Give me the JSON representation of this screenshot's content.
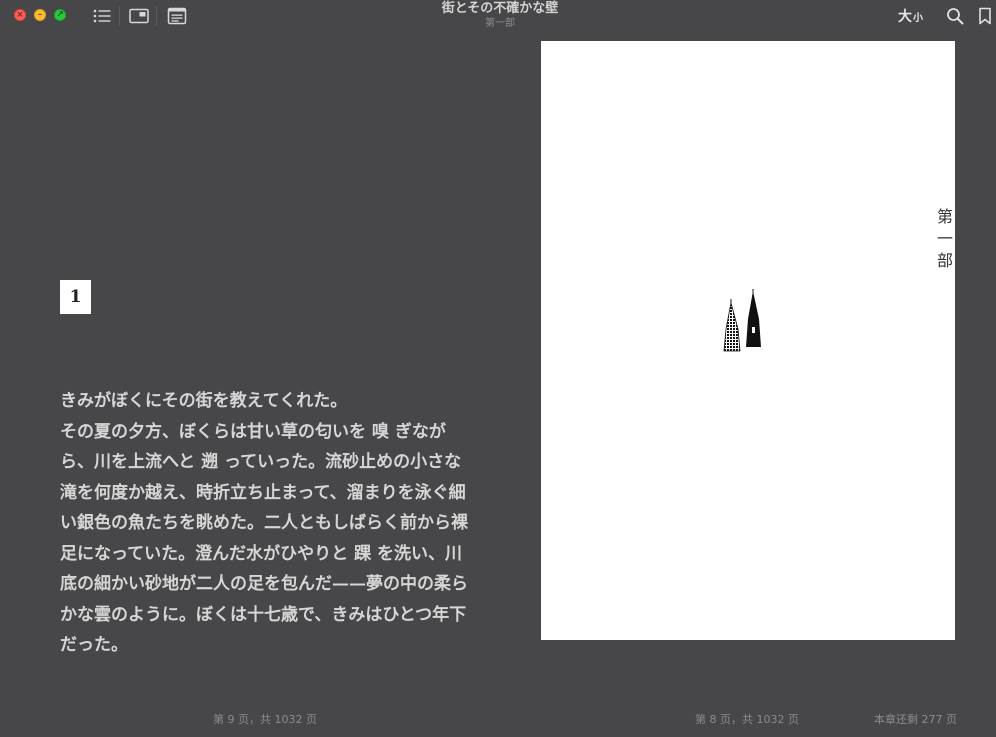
{
  "window": {
    "title": "街とその不確かな壁",
    "subtitle": "第一部"
  },
  "toolbar": {
    "font_size_big": "大",
    "font_size_small": "小",
    "icons": [
      "list-icon",
      "picture-in-picture-icon",
      "notes-icon",
      "search-icon",
      "bookmark-icon"
    ]
  },
  "left_page": {
    "chapter_number": "1",
    "paragraphs": [
      "きみがぼくにその街を教えてくれた。",
      "その夏の夕方、ぼくらは甘い草の匂いを 嗅 ぎながら、川を上流へと 遡 っていった。流砂止めの小さな滝を何度か越え、時折立ち止まって、溜まりを泳ぐ細い銀色の魚たちを眺めた。二人ともしばらく前から裸足になっていた。澄んだ水がひやりと 踝 を洗い、川底の細かい砂地が二人の足を包んだ——夢の中の柔らかな雲のように。ぼくは十七歳で、きみはひとつ年下だった。"
    ],
    "footer": "第 9 页，共 1032 页"
  },
  "right_page": {
    "part_title": "第一部",
    "footer": "第 8 页，共 1032 页",
    "remaining": "本章还剩 277 页"
  },
  "colors": {
    "background": "#474649",
    "page_white": "#ffffff",
    "text": "#d6d6d6",
    "close": "#ff5f57",
    "minimize": "#febc2e",
    "zoom": "#28c840"
  }
}
